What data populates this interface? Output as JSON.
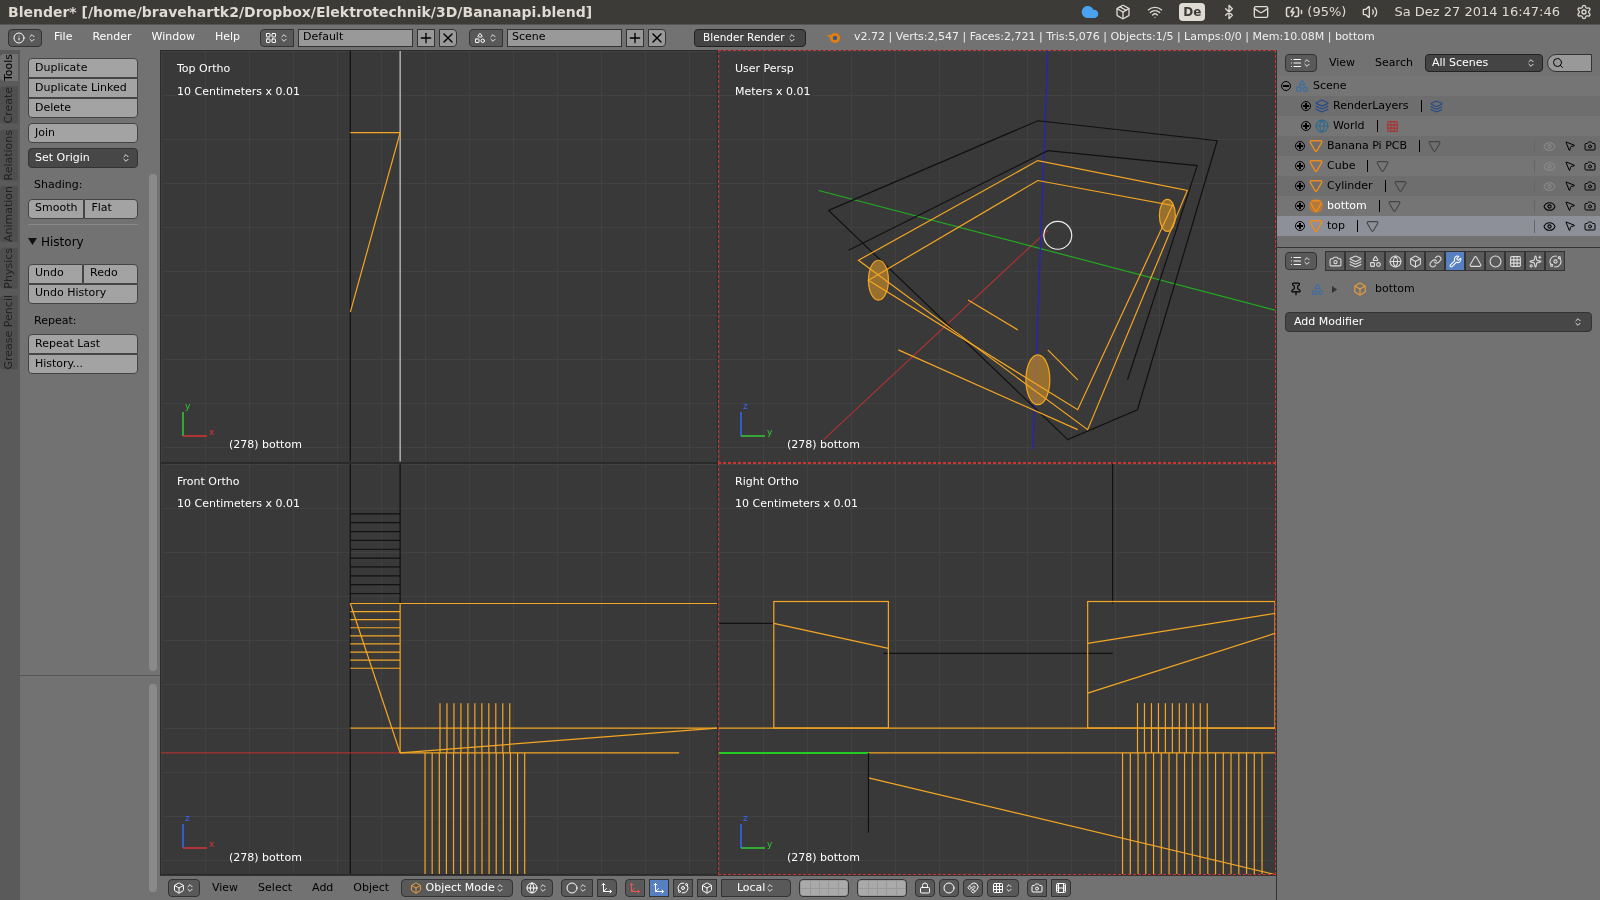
{
  "title_bar": {
    "title": "Blender* [/home/bravehartk2/Dropbox/Elektrotechnik/3D/Bananapi.blend]",
    "keyboard_layout": "De",
    "battery": "(95%)",
    "datetime": "Sa Dez 27 2014 16:47:46"
  },
  "info_header": {
    "menus": [
      "File",
      "Render",
      "Window",
      "Help"
    ],
    "layout": "Default",
    "scene": "Scene",
    "engine": "Blender Render",
    "stats": "v2.72 | Verts:2,547 | Faces:2,721 | Tris:5,076 | Objects:1/5 | Lamps:0/0 | Mem:10.08M | bottom"
  },
  "tool_tabs": [
    {
      "label": "Tools",
      "selected": true
    },
    {
      "label": "Create",
      "selected": false
    },
    {
      "label": "Relations",
      "selected": false
    },
    {
      "label": "Animation",
      "selected": false
    },
    {
      "label": "Physics",
      "selected": false
    },
    {
      "label": "Grease Pencil",
      "selected": false
    }
  ],
  "tool_panel": [
    {
      "kind": "stack",
      "rows": [
        [
          "Duplicate"
        ],
        [
          "Duplicate Linked"
        ],
        [
          "Delete"
        ]
      ]
    },
    {
      "kind": "stack",
      "rows": [
        [
          "Join"
        ]
      ]
    },
    {
      "kind": "dropdown",
      "label": "Set Origin"
    },
    {
      "kind": "label",
      "label": "Shading:"
    },
    {
      "kind": "stack",
      "rows": [
        [
          "Smooth",
          "Flat"
        ]
      ]
    },
    {
      "kind": "section",
      "label": "History",
      "expanded": true
    },
    {
      "kind": "stack",
      "rows": [
        [
          "Undo",
          "Redo"
        ],
        [
          "Undo History"
        ]
      ]
    },
    {
      "kind": "label",
      "label": "Repeat:"
    },
    {
      "kind": "stack",
      "rows": [
        [
          "Repeat Last"
        ],
        [
          "History..."
        ]
      ]
    }
  ],
  "viewports": [
    {
      "name": "Top Ortho",
      "scale": "10 Centimeters x 0.01",
      "object": "(278) bottom",
      "axes": [
        "y",
        "x"
      ]
    },
    {
      "name": "User Persp",
      "scale": "Meters x 0.01",
      "object": "(278) bottom",
      "axes": [
        "z",
        "y"
      ]
    },
    {
      "name": "Front Ortho",
      "scale": "10 Centimeters x 0.01",
      "object": "(278) bottom",
      "axes": [
        "z",
        "x"
      ]
    },
    {
      "name": "Right Ortho",
      "scale": "10 Centimeters x 0.01",
      "object": "(278) bottom",
      "axes": [
        "z",
        "y"
      ]
    }
  ],
  "outliner": {
    "menus": [
      "View",
      "Search"
    ],
    "filter": "All Scenes",
    "tree": [
      {
        "name": "Scene",
        "kind": "scene",
        "expanded": true,
        "children": [
          {
            "name": "RenderLayers",
            "kind": "renderlayers",
            "expanded": false
          },
          {
            "name": "World",
            "kind": "world",
            "expanded": false
          },
          {
            "name": "Banana Pi PCB",
            "kind": "mesh",
            "expanded": false,
            "visible": false,
            "active": false,
            "selected": false
          },
          {
            "name": "Cube",
            "kind": "mesh",
            "expanded": false,
            "visible": false,
            "active": false,
            "selected": false
          },
          {
            "name": "Cylinder",
            "kind": "mesh",
            "expanded": false,
            "visible": false,
            "active": false,
            "selected": false
          },
          {
            "name": "bottom",
            "kind": "mesh",
            "expanded": false,
            "visible": true,
            "active": true,
            "selected": false
          },
          {
            "name": "top",
            "kind": "mesh",
            "expanded": false,
            "visible": true,
            "active": false,
            "selected": true
          }
        ]
      }
    ]
  },
  "properties": {
    "tabs": [
      {
        "kind": "render",
        "selected": false
      },
      {
        "kind": "layers",
        "selected": false
      },
      {
        "kind": "scene",
        "selected": false
      },
      {
        "kind": "world",
        "selected": false
      },
      {
        "kind": "object",
        "selected": false
      },
      {
        "kind": "constraints",
        "selected": false
      },
      {
        "kind": "modifiers",
        "selected": true
      },
      {
        "kind": "data",
        "selected": false
      },
      {
        "kind": "material",
        "selected": false
      },
      {
        "kind": "texture",
        "selected": false
      },
      {
        "kind": "particles",
        "selected": false
      },
      {
        "kind": "physics",
        "selected": false
      }
    ],
    "context": "bottom",
    "add_modifier": "Add Modifier"
  },
  "bottom_header": {
    "menus": [
      "View",
      "Select",
      "Add",
      "Object"
    ],
    "mode": "Object Mode",
    "orientation": "Local"
  }
}
